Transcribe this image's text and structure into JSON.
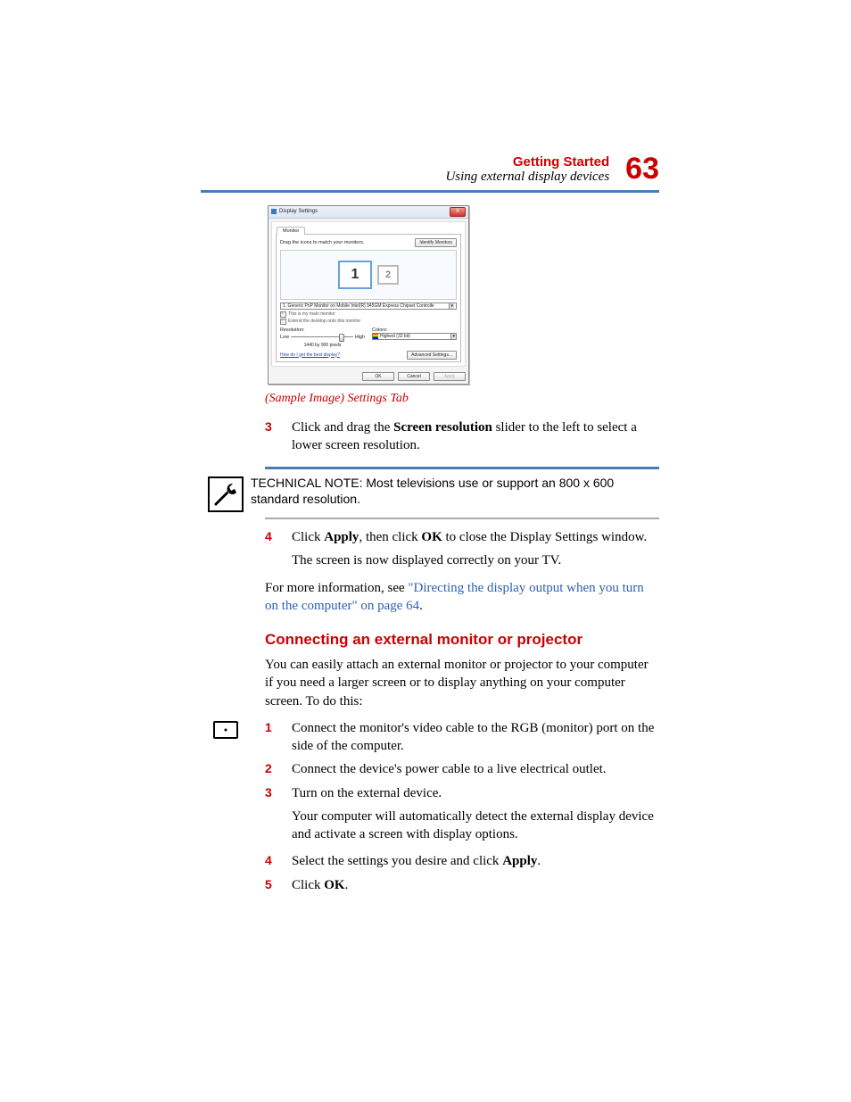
{
  "header": {
    "title": "Getting Started",
    "subtitle": "Using external display devices",
    "page_number": "63"
  },
  "dialog": {
    "title": "Display Settings",
    "close": "X",
    "tab": "Monitor",
    "instruction": "Drag the icons to match your monitors.",
    "identify_btn": "Identify Monitors",
    "monitor1": "1",
    "monitor2": "2",
    "monitor_select": "1. Generic PnP Monitor on Mobile Intel(R) 945GM Express Chipset Controlle",
    "check1": "This is my main monitor",
    "check2": "Extend the desktop onto this monitor",
    "res_label": "Resolution:",
    "low": "Low",
    "high": "High",
    "res_value": "1440 by 900 pixels",
    "colors_label": "Colors:",
    "colors_value": "Highest (32 bit)",
    "help_link": "How do I get the best display?",
    "adv_btn": "Advanced Settings...",
    "ok": "OK",
    "cancel": "Cancel",
    "apply": "Apply"
  },
  "caption": "(Sample Image) Settings Tab",
  "step3": {
    "num": "3",
    "pre": "Click and drag the ",
    "bold": "Screen resolution",
    "post": " slider to the left to select a lower screen resolution."
  },
  "note": "TECHNICAL NOTE: Most televisions use or support an 800 x 600 standard resolution.",
  "step4": {
    "num": "4",
    "t1": "Click ",
    "b1": "Apply",
    "t2": ", then click ",
    "b2": "OK",
    "t3": " to close the Display Settings window."
  },
  "post4": "The screen is now displayed correctly on your TV.",
  "for_more": {
    "pre": "For more information, see ",
    "link": "\"Directing the display output when you turn on the computer\" on page 64",
    "post": "."
  },
  "section_title": "Connecting an external monitor or projector",
  "section_intro": "You can easily attach an external monitor or projector to your computer if you need a larger screen or to display anything on your computer screen. To do this:",
  "s1": {
    "num": "1",
    "text": "Connect the monitor's video cable to the RGB (monitor) port on the side of the computer."
  },
  "s2": {
    "num": "2",
    "text": "Connect the device's power cable to a live electrical outlet."
  },
  "s3": {
    "num": "3",
    "text": "Turn on the external device."
  },
  "s3_sub": "Your computer will automatically detect the external display device and activate a screen with display options.",
  "s4": {
    "num": "4",
    "pre": "Select the settings you desire and click ",
    "b": "Apply",
    "post": "."
  },
  "s5": {
    "num": "5",
    "pre": "Click ",
    "b": "OK",
    "post": "."
  }
}
